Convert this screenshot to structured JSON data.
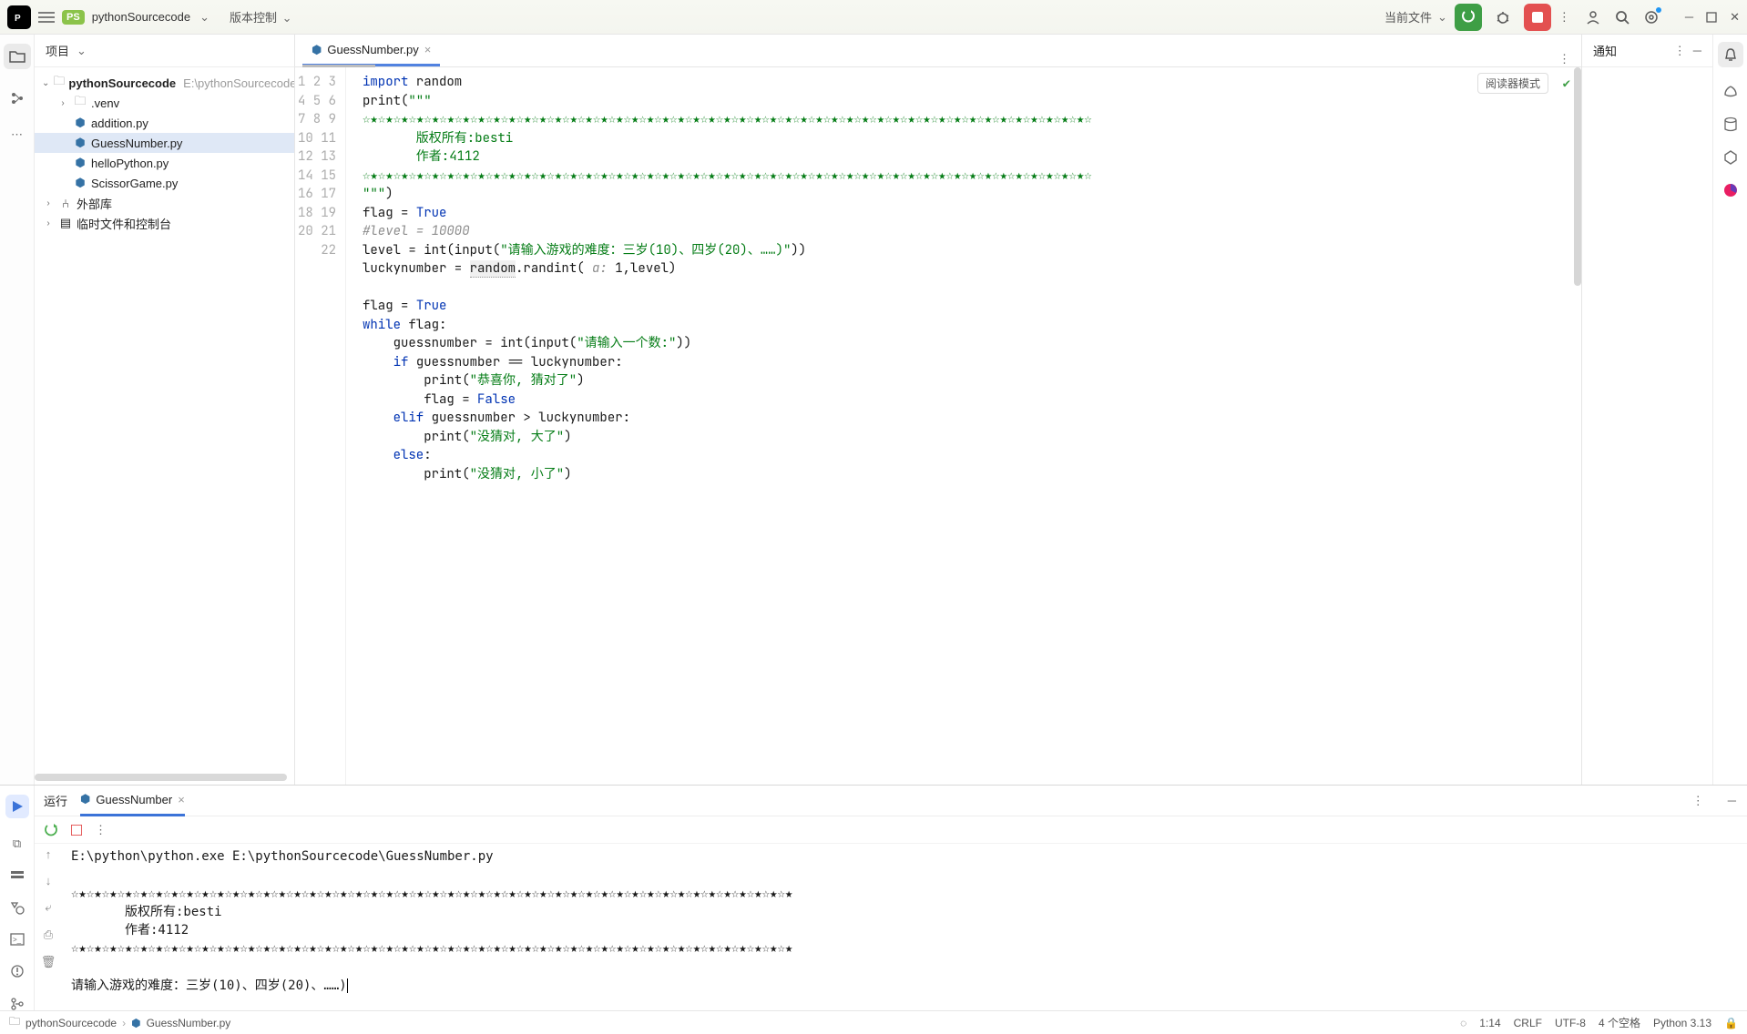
{
  "topbar": {
    "project_badge": "PS",
    "project_name": "pythonSourcecode",
    "vcs_label": "版本控制",
    "current_file_label": "当前文件"
  },
  "project": {
    "panel_title": "项目",
    "root_name": "pythonSourcecode",
    "root_path": "E:\\pythonSourcecode",
    "children": [
      {
        "name": ".venv",
        "type": "folder"
      },
      {
        "name": "addition.py",
        "type": "py"
      },
      {
        "name": "GuessNumber.py",
        "type": "py",
        "selected": true
      },
      {
        "name": "helloPython.py",
        "type": "py"
      },
      {
        "name": "ScissorGame.py",
        "type": "py"
      }
    ],
    "ext_libs": "外部库",
    "scratch": "临时文件和控制台"
  },
  "notify": {
    "title": "通知"
  },
  "editor": {
    "tab_file": "GuessNumber.py",
    "reader_mode": "阅读器模式",
    "star_line": "☆★☆★☆★☆★☆★☆★☆★☆★☆★☆★☆★☆★☆★☆★☆★☆★☆★☆★☆★☆★☆★☆★☆★☆★☆★☆★☆★☆★☆★☆★☆★☆★☆★☆★☆★☆★☆★☆★☆★☆★☆★☆★☆★☆★☆★☆★☆★☆",
    "copyright": "版权所有:besti",
    "author": "作者:4112",
    "level_prompt": "\"请输入游戏的难度：三岁(10)、四岁(20)、……)\"",
    "guess_prompt": "\"请输入一个数:\"",
    "msg_right": "\"恭喜你, 猜对了\"",
    "msg_big": "\"没猜对, 大了\"",
    "msg_small": "\"没猜对, 小了\"",
    "line_count": 22
  },
  "run": {
    "title": "运行",
    "tab_name": "GuessNumber",
    "cmd_line": "E:\\python\\python.exe E:\\pythonSourcecode\\GuessNumber.py",
    "star_line": "☆★☆★☆★☆★☆★☆★☆★☆★☆★☆★☆★☆★☆★☆★☆★☆★☆★☆★☆★☆★☆★☆★☆★☆★☆★☆★☆★☆★☆★☆★☆★☆★☆★☆★☆★☆★☆★☆★☆★☆★☆★☆★☆★☆★☆★☆★☆★",
    "copyright": "版权所有:besti",
    "author": "作者:4112",
    "prompt": "请输入游戏的难度：三岁(10)、四岁(20)、……)"
  },
  "status": {
    "crumb_root": "pythonSourcecode",
    "crumb_file": "GuessNumber.py",
    "pos": "1:14",
    "eol": "CRLF",
    "encoding": "UTF-8",
    "indent": "4 个空格",
    "interpreter": "Python 3.13"
  }
}
